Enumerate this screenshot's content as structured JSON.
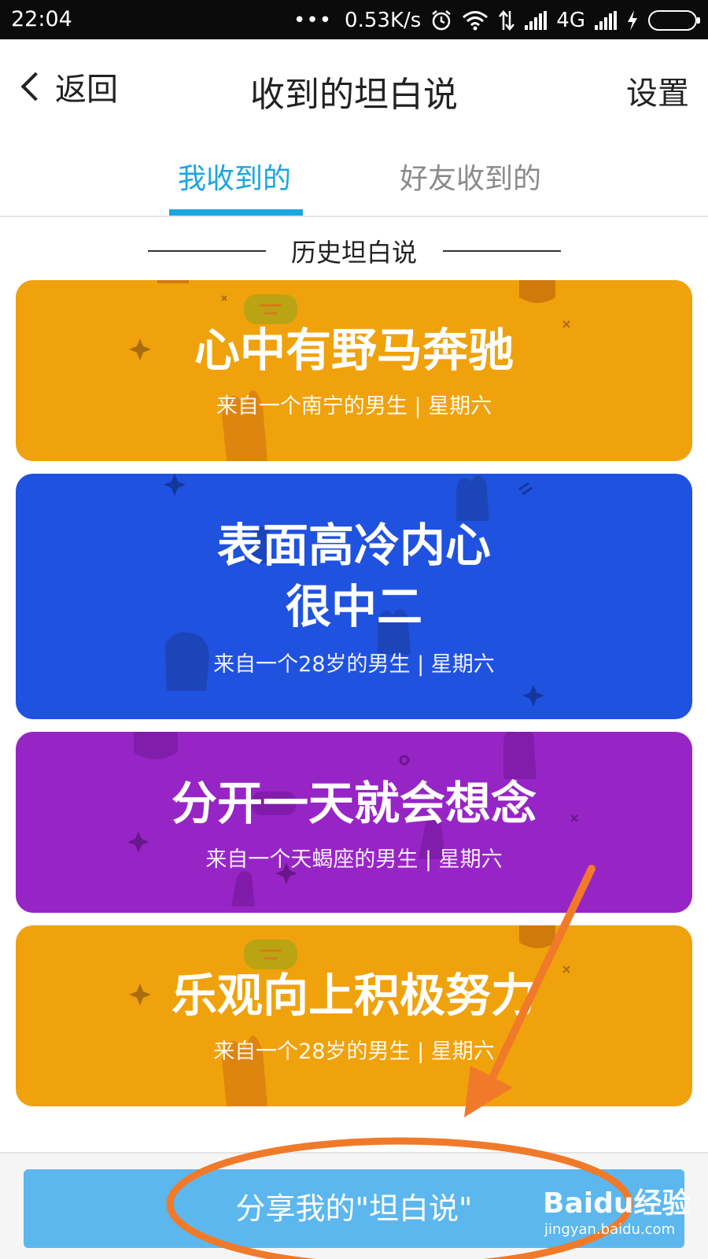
{
  "status_bar": {
    "time": "22:04",
    "dots": "•••",
    "speed": "0.53K/s",
    "network": "4G",
    "icons": [
      "alarm-icon",
      "wifi-icon",
      "data-arrows-icon",
      "signal-icon",
      "signal-icon",
      "charging-icon",
      "battery-icon"
    ]
  },
  "header": {
    "back_label": "返回",
    "title": "收到的坦白说",
    "settings_label": "设置"
  },
  "tabs": [
    {
      "label": "我收到的",
      "active": true
    },
    {
      "label": "好友收到的",
      "active": false
    }
  ],
  "section": {
    "title": "历史坦白说"
  },
  "cards": [
    {
      "title_lines": [
        "心中有野马奔驰"
      ],
      "subtitle": "来自一个南宁的男生 | 星期六",
      "color": "#f0a20c"
    },
    {
      "title_lines": [
        "表面高冷内心",
        "很中二"
      ],
      "subtitle": "来自一个28岁的男生 | 星期六",
      "color": "#2052e0"
    },
    {
      "title_lines": [
        "分开一天就会想念"
      ],
      "subtitle": "来自一个天蝎座的男生 | 星期六",
      "color": "#9725c6"
    },
    {
      "title_lines": [
        "乐观向上积极努力"
      ],
      "subtitle": "来自一个28岁的男生 | 星期六",
      "color": "#f0a20c"
    }
  ],
  "bottom": {
    "share_label": "分享我的\"坦白说\""
  },
  "watermark": {
    "logo": "Baidu经验",
    "url": "jingyan.baidu.com"
  },
  "annotation_color": "#f07a2a"
}
